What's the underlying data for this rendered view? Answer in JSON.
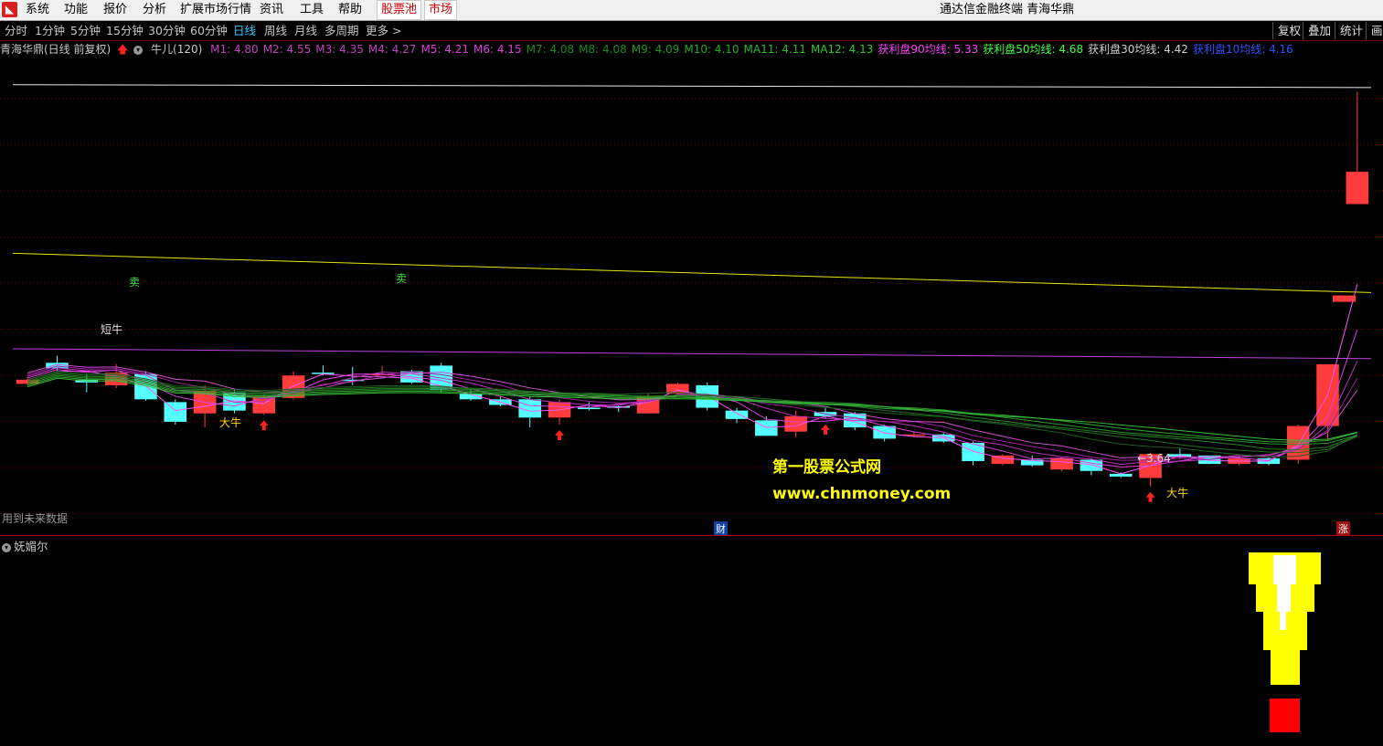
{
  "menubar": {
    "items": [
      "系统",
      "功能",
      "报价",
      "分析",
      "扩展市场行情",
      "资讯",
      "工具",
      "帮助"
    ],
    "boxed": [
      "股票池",
      "市场"
    ],
    "window_title": "通达信金融终端  青海华鼎"
  },
  "toolbar": {
    "periods": [
      "分时",
      "1分钟",
      "5分钟",
      "15分钟",
      "30分钟",
      "60分钟",
      "日线",
      "周线",
      "月线",
      "多周期",
      "更多 >"
    ],
    "active": "日线",
    "right_buttons": [
      "复权",
      "叠加",
      "统计",
      "画"
    ]
  },
  "chart_header": {
    "stock": "青海华鼎(日线 前复权)",
    "formula": "牛儿(120)",
    "indicators": [
      {
        "label": "M1: 4.80",
        "color": "#c040c0"
      },
      {
        "label": "M2: 4.55",
        "color": "#c040c0"
      },
      {
        "label": "M3: 4.35",
        "color": "#c040c0"
      },
      {
        "label": "M4: 4.27",
        "color": "#c040c0"
      },
      {
        "label": "M5: 4.21",
        "color": "#e040e0"
      },
      {
        "label": "M6: 4.15",
        "color": "#e040e0"
      },
      {
        "label": "M7: 4.08",
        "color": "#1f8a1f"
      },
      {
        "label": "M8: 4.08",
        "color": "#1f8a1f"
      },
      {
        "label": "M9: 4.09",
        "color": "#1f9a1f"
      },
      {
        "label": "M10: 4.10",
        "color": "#22aa22"
      },
      {
        "label": "MA11: 4.11",
        "color": "#26bb26"
      },
      {
        "label": "MA12: 4.13",
        "color": "#2acc2a"
      },
      {
        "label": "获利盘90均线: 5.33",
        "color": "#ff40ff"
      },
      {
        "label": "获利盘50均线: 4.68",
        "color": "#40ff40"
      },
      {
        "label": "获利盘30均线: 4.42",
        "color": "#d0d0d0"
      },
      {
        "label": "获利盘10均线: 4.16",
        "color": "#3050ff"
      }
    ]
  },
  "annotations": {
    "sell1": "卖",
    "sell2": "卖",
    "short": "短牛",
    "bull1": "大牛",
    "bull2": "大牛",
    "low_price": "3.64",
    "future_note": "用到未来数据",
    "cai": "财",
    "zhang": "涨"
  },
  "watermark": {
    "line1": "第一股票公式网",
    "line2": "www.chnmoney.com"
  },
  "subchart": {
    "title": "妩媚尔"
  },
  "chart_data": {
    "type": "candlestick",
    "ylim": [
      3.3,
      6.7
    ],
    "candles": [
      {
        "o": 4.37,
        "c": 4.4,
        "h": 4.42,
        "l": 4.36,
        "color": "red"
      },
      {
        "o": 4.48,
        "c": 4.52,
        "h": 4.57,
        "l": 4.46,
        "color": "cyan"
      },
      {
        "o": 4.38,
        "c": 4.4,
        "h": 4.44,
        "l": 4.31,
        "color": "cyan"
      },
      {
        "o": 4.36,
        "c": 4.45,
        "h": 4.51,
        "l": 4.34,
        "color": "red"
      },
      {
        "o": 4.44,
        "c": 4.26,
        "h": 4.46,
        "l": 4.25,
        "color": "cyan"
      },
      {
        "o": 4.24,
        "c": 4.1,
        "h": 4.26,
        "l": 4.08,
        "color": "cyan"
      },
      {
        "o": 4.16,
        "c": 4.32,
        "h": 4.36,
        "l": 4.06,
        "color": "red"
      },
      {
        "o": 4.31,
        "c": 4.18,
        "h": 4.33,
        "l": 4.16,
        "color": "cyan"
      },
      {
        "o": 4.16,
        "c": 4.28,
        "h": 4.29,
        "l": 4.15,
        "color": "red"
      },
      {
        "o": 4.27,
        "c": 4.43,
        "h": 4.46,
        "l": 4.26,
        "color": "red"
      },
      {
        "o": 4.45,
        "c": 4.45,
        "h": 4.5,
        "l": 4.43,
        "color": "cyan"
      },
      {
        "o": 4.4,
        "c": 4.4,
        "h": 4.49,
        "l": 4.36,
        "color": "cyan"
      },
      {
        "o": 4.44,
        "c": 4.44,
        "h": 4.5,
        "l": 4.43,
        "color": "red"
      },
      {
        "o": 4.46,
        "c": 4.38,
        "h": 4.47,
        "l": 4.37,
        "color": "cyan"
      },
      {
        "o": 4.5,
        "c": 4.33,
        "h": 4.52,
        "l": 4.31,
        "color": "cyan"
      },
      {
        "o": 4.3,
        "c": 4.26,
        "h": 4.33,
        "l": 4.25,
        "color": "cyan"
      },
      {
        "o": 4.26,
        "c": 4.22,
        "h": 4.28,
        "l": 4.21,
        "color": "cyan"
      },
      {
        "o": 4.26,
        "c": 4.13,
        "h": 4.28,
        "l": 4.06,
        "color": "cyan"
      },
      {
        "o": 4.13,
        "c": 4.24,
        "h": 4.26,
        "l": 4.08,
        "color": "red"
      },
      {
        "o": 4.2,
        "c": 4.2,
        "h": 4.24,
        "l": 4.18,
        "color": "cyan"
      },
      {
        "o": 4.21,
        "c": 4.2,
        "h": 4.22,
        "l": 4.17,
        "color": "cyan"
      },
      {
        "o": 4.16,
        "c": 4.28,
        "h": 4.3,
        "l": 4.16,
        "color": "red"
      },
      {
        "o": 4.3,
        "c": 4.37,
        "h": 4.38,
        "l": 4.29,
        "color": "red"
      },
      {
        "o": 4.36,
        "c": 4.2,
        "h": 4.38,
        "l": 4.18,
        "color": "cyan"
      },
      {
        "o": 4.18,
        "c": 4.12,
        "h": 4.2,
        "l": 4.09,
        "color": "cyan"
      },
      {
        "o": 4.11,
        "c": 4.0,
        "h": 4.14,
        "l": 4.0,
        "color": "cyan"
      },
      {
        "o": 4.03,
        "c": 4.14,
        "h": 4.18,
        "l": 3.99,
        "color": "red"
      },
      {
        "o": 4.17,
        "c": 4.14,
        "h": 4.2,
        "l": 4.12,
        "color": "cyan"
      },
      {
        "o": 4.16,
        "c": 4.06,
        "h": 4.17,
        "l": 4.04,
        "color": "cyan"
      },
      {
        "o": 4.07,
        "c": 3.98,
        "h": 4.08,
        "l": 3.96,
        "color": "cyan"
      },
      {
        "o": 4.01,
        "c": 4.01,
        "h": 4.03,
        "l": 3.99,
        "color": "red"
      },
      {
        "o": 4.01,
        "c": 3.96,
        "h": 4.02,
        "l": 3.95,
        "color": "cyan"
      },
      {
        "o": 3.95,
        "c": 3.82,
        "h": 3.96,
        "l": 3.79,
        "color": "cyan"
      },
      {
        "o": 3.8,
        "c": 3.86,
        "h": 3.87,
        "l": 3.79,
        "color": "red"
      },
      {
        "o": 3.83,
        "c": 3.79,
        "h": 3.86,
        "l": 3.78,
        "color": "cyan"
      },
      {
        "o": 3.76,
        "c": 3.84,
        "h": 3.85,
        "l": 3.75,
        "color": "red"
      },
      {
        "o": 3.83,
        "c": 3.75,
        "h": 3.84,
        "l": 3.72,
        "color": "cyan"
      },
      {
        "o": 3.73,
        "c": 3.71,
        "h": 3.74,
        "l": 3.7,
        "color": "cyan"
      },
      {
        "o": 3.7,
        "c": 3.87,
        "h": 3.88,
        "l": 3.64,
        "color": "red"
      },
      {
        "o": 3.87,
        "c": 3.85,
        "h": 3.91,
        "l": 3.84,
        "color": "cyan"
      },
      {
        "o": 3.86,
        "c": 3.8,
        "h": 3.86,
        "l": 3.8,
        "color": "cyan"
      },
      {
        "o": 3.8,
        "c": 3.84,
        "h": 3.86,
        "l": 3.79,
        "color": "red"
      },
      {
        "o": 3.84,
        "c": 3.8,
        "h": 3.85,
        "l": 3.79,
        "color": "cyan"
      },
      {
        "o": 3.83,
        "c": 4.07,
        "h": 4.08,
        "l": 3.8,
        "color": "red"
      },
      {
        "o": 4.07,
        "c": 4.51,
        "h": 4.51,
        "l": 3.97,
        "color": "red"
      },
      {
        "o": 5.88,
        "c": 5.65,
        "h": 6.45,
        "l": 5.75,
        "color": "red"
      }
    ],
    "limit_marker_price": 4.98,
    "levels": [
      {
        "name": "获利盘90均线",
        "from": 6.5,
        "to": 6.48,
        "color": "#e8e8e8"
      },
      {
        "name": "获利盘50均线",
        "from": 5.3,
        "to": 5.02,
        "color": "#e6e600"
      },
      {
        "name": "获利盘30均线",
        "from": 4.62,
        "to": 4.55,
        "color": "#c040e0"
      }
    ]
  }
}
